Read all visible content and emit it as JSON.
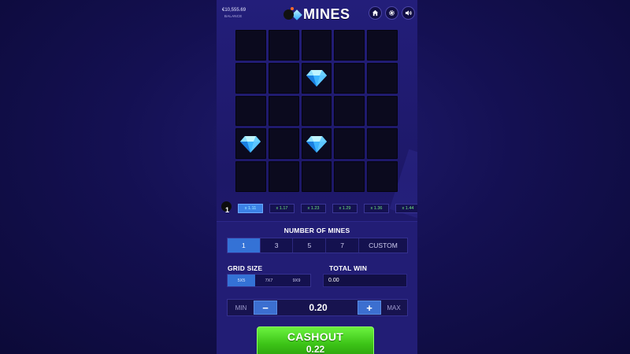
{
  "header": {
    "balance_value": "€10,555.69",
    "balance_label": "BALANCE",
    "logo_text": "MINES"
  },
  "icons": {
    "home": "home-icon",
    "settings": "gear-icon",
    "sound": "speaker-icon"
  },
  "grid": {
    "size": 5,
    "revealed_gems": [
      [
        1,
        2
      ],
      [
        3,
        0
      ],
      [
        3,
        2
      ]
    ]
  },
  "mine_counter": "1",
  "multipliers": [
    "x 1.11",
    "x 1.17",
    "x 1.23",
    "x 1.29",
    "x 1.36",
    "x 1.44"
  ],
  "active_multiplier_index": 0,
  "mines": {
    "title": "NUMBER OF MINES",
    "options": [
      "1",
      "3",
      "5",
      "7",
      "CUSTOM"
    ],
    "selected_index": 0
  },
  "grid_size": {
    "title": "GRID SIZE",
    "options": [
      "5X5",
      "7X7",
      "9X9"
    ],
    "selected_index": 0
  },
  "total_win": {
    "title": "TOTAL WIN",
    "value": "0.00"
  },
  "bet": {
    "min_label": "MIN",
    "max_label": "MAX",
    "minus_label": "−",
    "plus_label": "+",
    "value": "0.20"
  },
  "cashout": {
    "label": "CASHOUT",
    "amount": "0.22"
  },
  "colors": {
    "accent_blue": "#3472d6",
    "cashout_green": "#3cc317",
    "multiplier_green": "#6ee37b",
    "gem_blue": "#2ba8ff"
  }
}
